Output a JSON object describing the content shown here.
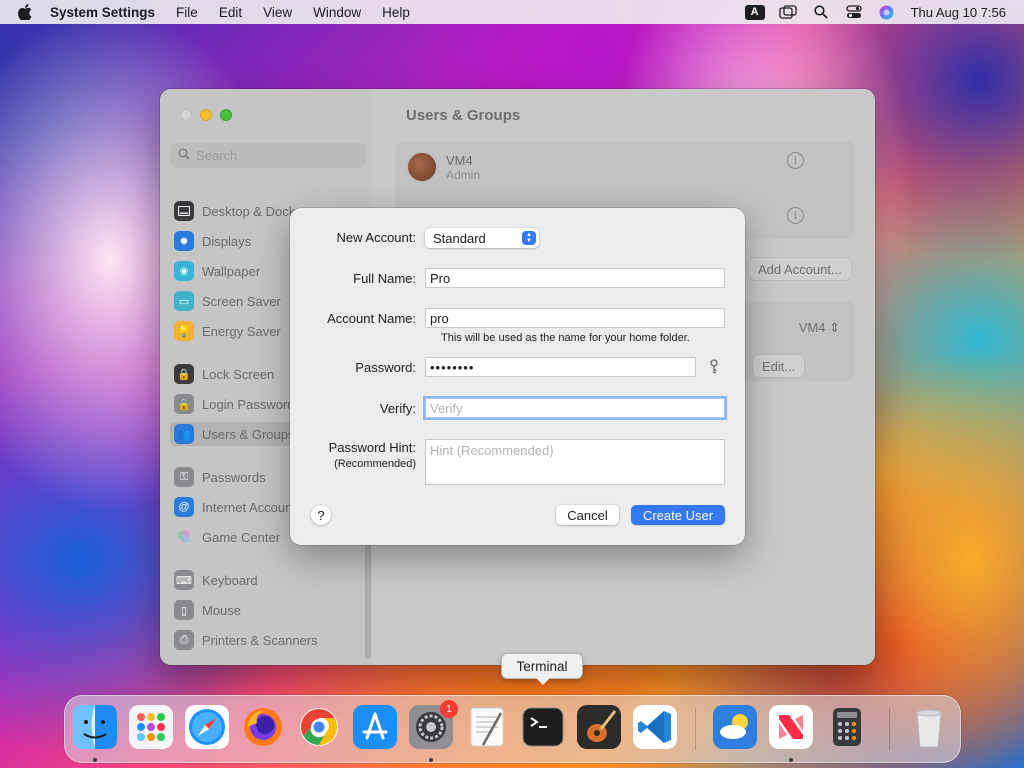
{
  "menubar": {
    "app_name": "System Settings",
    "items": [
      "File",
      "Edit",
      "View",
      "Window",
      "Help"
    ],
    "keyboard_badge": "A",
    "clock": "Thu Aug 10  7:56"
  },
  "sidebar": {
    "search_placeholder": "Search",
    "items": [
      {
        "label": "Desktop & Dock",
        "icon": "desktop-icon",
        "color": "#2f2f33"
      },
      {
        "label": "Displays",
        "icon": "displays-icon",
        "color": "#2a7bde"
      },
      {
        "label": "Wallpaper",
        "icon": "wallpaper-icon",
        "color": "#39b3d7"
      },
      {
        "label": "Screen Saver",
        "icon": "screensaver-icon",
        "color": "#41b3c8"
      },
      {
        "label": "Energy Saver",
        "icon": "energy-icon",
        "color": "#f4b330"
      },
      {
        "label": "Lock Screen",
        "icon": "lock-icon",
        "color": "#2f2f33"
      },
      {
        "label": "Login Password",
        "icon": "login-lock-icon",
        "color": "#8a8a8e"
      },
      {
        "label": "Users & Groups",
        "icon": "users-icon",
        "color": "#2a7bde"
      },
      {
        "label": "Passwords",
        "icon": "key-icon",
        "color": "#8a8a8e"
      },
      {
        "label": "Internet Accounts",
        "icon": "at-icon",
        "color": "#2a7bde"
      },
      {
        "label": "Game Center",
        "icon": "gamecenter-icon",
        "color": "#c9c9c9"
      },
      {
        "label": "Keyboard",
        "icon": "keyboard-icon",
        "color": "#8a8a8e"
      },
      {
        "label": "Mouse",
        "icon": "mouse-icon",
        "color": "#8a8a8e"
      },
      {
        "label": "Printers & Scanners",
        "icon": "printer-icon",
        "color": "#8a8a8e"
      }
    ]
  },
  "content": {
    "title": "Users & Groups",
    "user": {
      "name": "VM4",
      "role": "Admin"
    },
    "add_account_label": "Add Account...",
    "vm_select_value": "VM4",
    "edit_label": "Edit...",
    "help_label": "?"
  },
  "dialog": {
    "new_account_label": "New Account:",
    "new_account_value": "Standard",
    "full_name_label": "Full Name:",
    "full_name_value": "Pro",
    "account_name_label": "Account Name:",
    "account_name_value": "pro",
    "account_name_hint": "This will be used as the name for your home folder.",
    "password_label": "Password:",
    "password_value": "••••••••",
    "verify_label": "Verify:",
    "verify_placeholder": "Verify",
    "password_hint_label": "Password Hint:",
    "password_hint_sublabel": "(Recommended)",
    "password_hint_placeholder": "Hint (Recommended)",
    "help_label": "?",
    "cancel_label": "Cancel",
    "create_label": "Create User"
  },
  "tooltip": {
    "text": "Terminal"
  },
  "dock": {
    "apps": [
      {
        "name": "Finder",
        "icon": "finder-icon",
        "running": true
      },
      {
        "name": "Launchpad",
        "icon": "launchpad-icon",
        "running": false
      },
      {
        "name": "Safari",
        "icon": "safari-icon",
        "running": false
      },
      {
        "name": "Firefox",
        "icon": "firefox-icon",
        "running": false
      },
      {
        "name": "Chrome",
        "icon": "chrome-icon",
        "running": false
      },
      {
        "name": "App Store",
        "icon": "appstore-icon",
        "running": false
      },
      {
        "name": "System Settings",
        "icon": "settings-icon",
        "running": true,
        "badge": "1"
      },
      {
        "name": "TextEdit",
        "icon": "textedit-icon",
        "running": false
      },
      {
        "name": "Terminal",
        "icon": "terminal-icon",
        "running": false
      },
      {
        "name": "GarageBand",
        "icon": "garageband-icon",
        "running": false
      },
      {
        "name": "VS Code",
        "icon": "vscode-icon",
        "running": false
      },
      {
        "name": "Weather",
        "icon": "weather-icon",
        "running": false
      },
      {
        "name": "News",
        "icon": "news-icon",
        "running": true
      },
      {
        "name": "Calculator",
        "icon": "calculator-icon",
        "running": false
      },
      {
        "name": "Trash",
        "icon": "trash-icon",
        "running": false
      }
    ]
  }
}
